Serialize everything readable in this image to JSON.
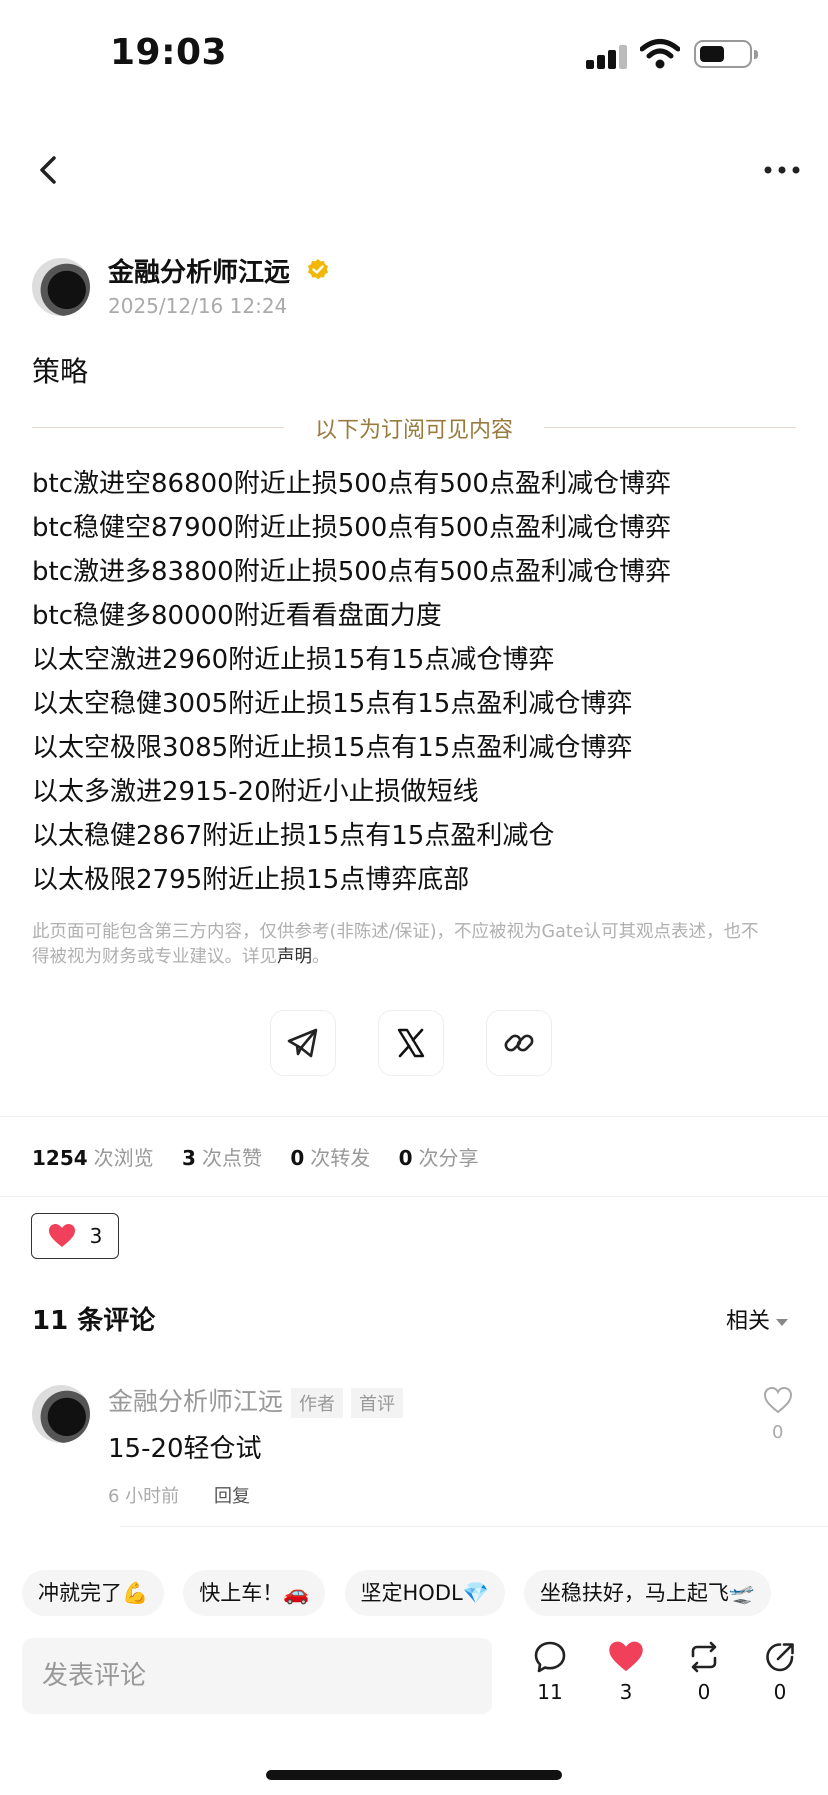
{
  "status_bar": {
    "time": "19:03"
  },
  "author": {
    "name": "金融分析师江远",
    "date": "2025/12/16 12:24"
  },
  "post": {
    "title": "策略",
    "subscriber_divider": "以下为订阅可见内容",
    "lines": [
      "btc激进空86800附近止损500点有500点盈利减仓博弈",
      "btc稳健空87900附近止损500点有500点盈利减仓博弈",
      "btc激进多83800附近止损500点有500点盈利减仓博弈",
      "btc稳健多80000附近看看盘面力度",
      "以太空激进2960附近止损15有15点减仓博弈",
      "以太空稳健3005附近止损15点有15点盈利减仓博弈",
      "以太空极限3085附近止损15点有15点盈利减仓博弈",
      "以太多激进2915-20附近小止损做短线",
      "以太稳健2867附近止损15点有15点盈利减仓",
      "以太极限2795附近止损15点博弈底部"
    ],
    "disclaimer": "此页面可能包含第三方内容，仅供参考(非陈述/保证)，不应被视为Gate认可其观点表述，也不得被视为财务或专业建议。详见",
    "disclaimer_link": "声明",
    "disclaimer_end": "。"
  },
  "stats": {
    "views": "1254",
    "views_label": "次浏览",
    "likes": "3",
    "likes_label": "次点赞",
    "reposts": "0",
    "reposts_label": "次转发",
    "shares": "0",
    "shares_label": "次分享"
  },
  "reaction": {
    "count": "3"
  },
  "comments": {
    "title": "11 条评论",
    "sort": "相关",
    "items": [
      {
        "name": "金融分析师江远",
        "tag_author": "作者",
        "tag_first": "首评",
        "text": "15-20轻仓试",
        "time": "6 小时前",
        "reply": "回复",
        "likes": "0"
      }
    ]
  },
  "quick_replies": [
    "冲就完了💪",
    "快上车！🚗",
    "坚定HODL💎",
    "坐稳扶好，马上起飞🛫"
  ],
  "bottom_bar": {
    "input_placeholder": "发表评论",
    "comment_count": "11",
    "like_count": "3",
    "repost_count": "0",
    "share_count": "0"
  },
  "colors": {
    "accent_gold": "#9a7b3e",
    "heart_red": "#f0405a",
    "verified_gold": "#f2b705"
  }
}
